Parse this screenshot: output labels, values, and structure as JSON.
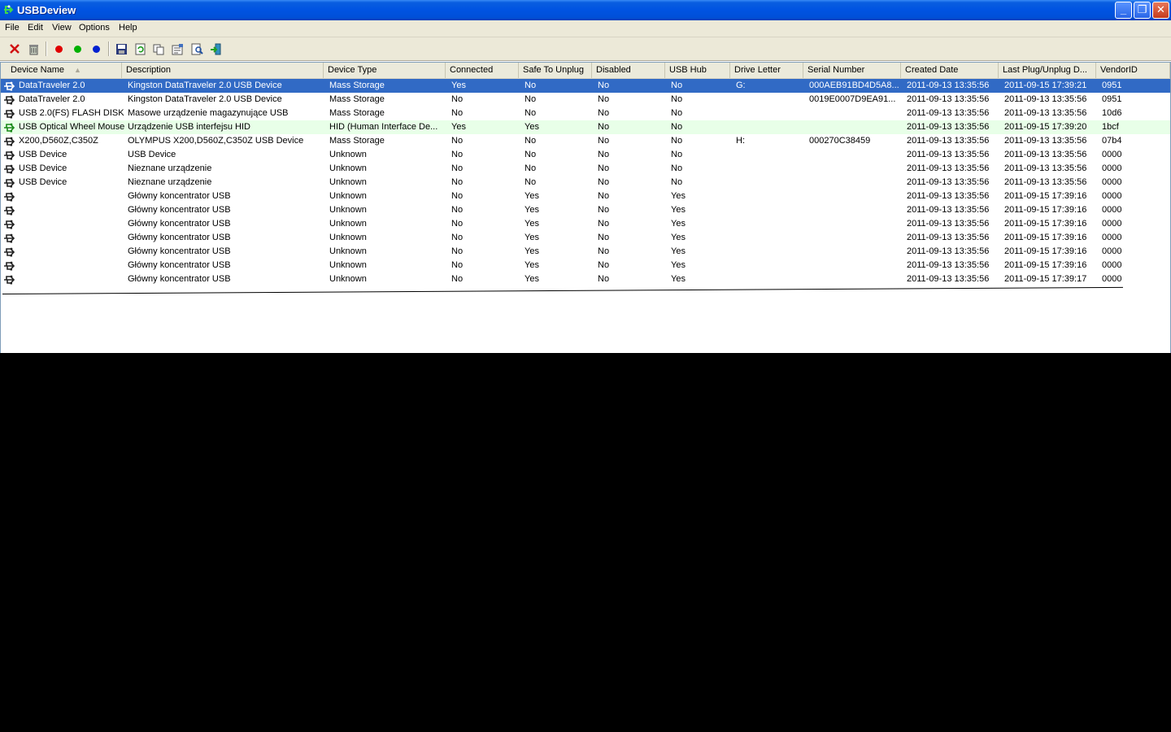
{
  "window": {
    "title": "USBDeview"
  },
  "menu": [
    "File",
    "Edit",
    "View",
    "Options",
    "Help"
  ],
  "toolbar": {
    "icons": [
      "delete-icon",
      "uninstall-icon",
      "disconnect-icon",
      "connect-icon",
      "reconnect-icon",
      "save-icon",
      "refresh-icon",
      "copy-icon",
      "properties-icon",
      "find-icon",
      "exit-icon"
    ],
    "colors": {
      "disconnect": "#e00000",
      "connect": "#00b000",
      "reconnect": "#0020d0"
    }
  },
  "columns": [
    "Device Name",
    "Description",
    "Device Type",
    "Connected",
    "Safe To Unplug",
    "Disabled",
    "USB Hub",
    "Drive Letter",
    "Serial Number",
    "Created Date",
    "Last Plug/Unplug D...",
    "VendorID"
  ],
  "rows": [
    {
      "name": "DataTraveler 2.0",
      "desc": "Kingston DataTraveler 2.0 USB Device",
      "type": "Mass Storage",
      "connected": "Yes",
      "safe": "No",
      "disabled": "No",
      "hub": "No",
      "drive": "G:",
      "serial": "000AEB91BD4D5A8...",
      "created": "2011-09-13 13:35:56",
      "last": "2011-09-15 17:39:21",
      "vendor": "0951",
      "state": "selected"
    },
    {
      "name": "DataTraveler 2.0",
      "desc": "Kingston DataTraveler 2.0 USB Device",
      "type": "Mass Storage",
      "connected": "No",
      "safe": "No",
      "disabled": "No",
      "hub": "No",
      "drive": "",
      "serial": "0019E0007D9EA91...",
      "created": "2011-09-13 13:35:56",
      "last": "2011-09-13 13:35:56",
      "vendor": "0951",
      "state": ""
    },
    {
      "name": "USB 2.0(FS) FLASH DISK",
      "desc": "Masowe urządzenie magazynujące USB",
      "type": "Mass Storage",
      "connected": "No",
      "safe": "No",
      "disabled": "No",
      "hub": "No",
      "drive": "",
      "serial": "",
      "created": "2011-09-13 13:35:56",
      "last": "2011-09-13 13:35:56",
      "vendor": "10d6",
      "state": ""
    },
    {
      "name": "USB Optical Wheel Mouse",
      "desc": "Urządzenie USB interfejsu HID",
      "type": "HID (Human Interface De...",
      "connected": "Yes",
      "safe": "Yes",
      "disabled": "No",
      "hub": "No",
      "drive": "",
      "serial": "",
      "created": "2011-09-13 13:35:56",
      "last": "2011-09-15 17:39:20",
      "vendor": "1bcf",
      "state": "green"
    },
    {
      "name": "X200,D560Z,C350Z",
      "desc": "OLYMPUS X200,D560Z,C350Z USB Device",
      "type": "Mass Storage",
      "connected": "No",
      "safe": "No",
      "disabled": "No",
      "hub": "No",
      "drive": "H:",
      "serial": "000270C38459",
      "created": "2011-09-13 13:35:56",
      "last": "2011-09-13 13:35:56",
      "vendor": "07b4",
      "state": ""
    },
    {
      "name": "USB Device",
      "desc": "USB Device",
      "type": "Unknown",
      "connected": "No",
      "safe": "No",
      "disabled": "No",
      "hub": "No",
      "drive": "",
      "serial": "",
      "created": "2011-09-13 13:35:56",
      "last": "2011-09-13 13:35:56",
      "vendor": "0000",
      "state": ""
    },
    {
      "name": "USB Device",
      "desc": "Nieznane urządzenie",
      "type": "Unknown",
      "connected": "No",
      "safe": "No",
      "disabled": "No",
      "hub": "No",
      "drive": "",
      "serial": "",
      "created": "2011-09-13 13:35:56",
      "last": "2011-09-13 13:35:56",
      "vendor": "0000",
      "state": ""
    },
    {
      "name": "USB Device",
      "desc": "Nieznane urządzenie",
      "type": "Unknown",
      "connected": "No",
      "safe": "No",
      "disabled": "No",
      "hub": "No",
      "drive": "",
      "serial": "",
      "created": "2011-09-13 13:35:56",
      "last": "2011-09-13 13:35:56",
      "vendor": "0000",
      "state": ""
    },
    {
      "name": "",
      "desc": "Główny koncentrator USB",
      "type": "Unknown",
      "connected": "No",
      "safe": "Yes",
      "disabled": "No",
      "hub": "Yes",
      "drive": "",
      "serial": "",
      "created": "2011-09-13 13:35:56",
      "last": "2011-09-15 17:39:16",
      "vendor": "0000",
      "state": ""
    },
    {
      "name": "",
      "desc": "Główny koncentrator USB",
      "type": "Unknown",
      "connected": "No",
      "safe": "Yes",
      "disabled": "No",
      "hub": "Yes",
      "drive": "",
      "serial": "",
      "created": "2011-09-13 13:35:56",
      "last": "2011-09-15 17:39:16",
      "vendor": "0000",
      "state": ""
    },
    {
      "name": "",
      "desc": "Główny koncentrator USB",
      "type": "Unknown",
      "connected": "No",
      "safe": "Yes",
      "disabled": "No",
      "hub": "Yes",
      "drive": "",
      "serial": "",
      "created": "2011-09-13 13:35:56",
      "last": "2011-09-15 17:39:16",
      "vendor": "0000",
      "state": ""
    },
    {
      "name": "",
      "desc": "Główny koncentrator USB",
      "type": "Unknown",
      "connected": "No",
      "safe": "Yes",
      "disabled": "No",
      "hub": "Yes",
      "drive": "",
      "serial": "",
      "created": "2011-09-13 13:35:56",
      "last": "2011-09-15 17:39:16",
      "vendor": "0000",
      "state": ""
    },
    {
      "name": "",
      "desc": "Główny koncentrator USB",
      "type": "Unknown",
      "connected": "No",
      "safe": "Yes",
      "disabled": "No",
      "hub": "Yes",
      "drive": "",
      "serial": "",
      "created": "2011-09-13 13:35:56",
      "last": "2011-09-15 17:39:16",
      "vendor": "0000",
      "state": ""
    },
    {
      "name": "",
      "desc": "Główny koncentrator USB",
      "type": "Unknown",
      "connected": "No",
      "safe": "Yes",
      "disabled": "No",
      "hub": "Yes",
      "drive": "",
      "serial": "",
      "created": "2011-09-13 13:35:56",
      "last": "2011-09-15 17:39:16",
      "vendor": "0000",
      "state": ""
    },
    {
      "name": "",
      "desc": "Główny koncentrator USB",
      "type": "Unknown",
      "connected": "No",
      "safe": "Yes",
      "disabled": "No",
      "hub": "Yes",
      "drive": "",
      "serial": "",
      "created": "2011-09-13 13:35:56",
      "last": "2011-09-15 17:39:17",
      "vendor": "0000",
      "state": ""
    }
  ]
}
